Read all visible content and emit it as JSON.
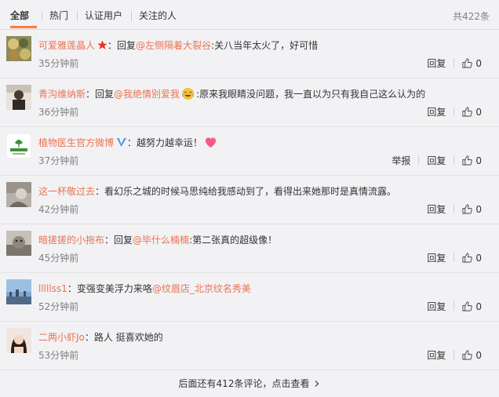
{
  "tabs": [
    "全部",
    "热门",
    "认证用户",
    "关注的人"
  ],
  "total": "共422条",
  "comments": [
    {
      "user": "可爱雅莲晶人",
      "badge": "star",
      "sep": "：",
      "prefix": "回复",
      "mention": "@左侧隔着大裂谷",
      "text": ":关八当年太火了，好可惜",
      "time": "35分钟前",
      "reply": "回复",
      "likes": "0"
    },
    {
      "user": "青沟维纳斯",
      "sep": "：",
      "prefix": "回复",
      "mention": "@我绝情别爱我",
      "text": ":原来我眼睛没问题，我一直以为只有我自己这么认为的",
      "time": "36分钟前",
      "reply": "回复",
      "likes": "0"
    },
    {
      "user": "植物医生官方微博",
      "badge": "v",
      "sep": "：",
      "text": "越努力越幸运！",
      "time": "37分钟前",
      "report": "举报",
      "reply": "回复",
      "likes": "0"
    },
    {
      "user": "这一杯敬过去",
      "sep": "：",
      "text": "看幻乐之城的时候马思纯给我感动到了，看得出来她那时是真情流露。",
      "time": "42分钟前",
      "reply": "回复",
      "likes": "0"
    },
    {
      "user": "暗搓搓的小拖布",
      "sep": "：",
      "prefix": "回复",
      "mention": "@毕什么楠楠",
      "text": ":第二张真的超级像！",
      "time": "45分钟前",
      "reply": "回复",
      "likes": "0"
    },
    {
      "user": "lllllss1",
      "sep": "：",
      "text": "变强变美浮力来咯",
      "mention": "@纹眉店_北京纹名秀美",
      "time": "52分钟前",
      "reply": "回复",
      "likes": "0"
    },
    {
      "user": "二两小虾Jo",
      "sep": "：",
      "text": "路人 挺喜欢她的",
      "time": "53分钟前",
      "reply": "回复",
      "likes": "0"
    }
  ],
  "footer": "后面还有412条评论，点击查看",
  "colors": {
    "accent": "#eb7350",
    "tab_underline": "#fa7d3c",
    "muted": "#808080"
  }
}
